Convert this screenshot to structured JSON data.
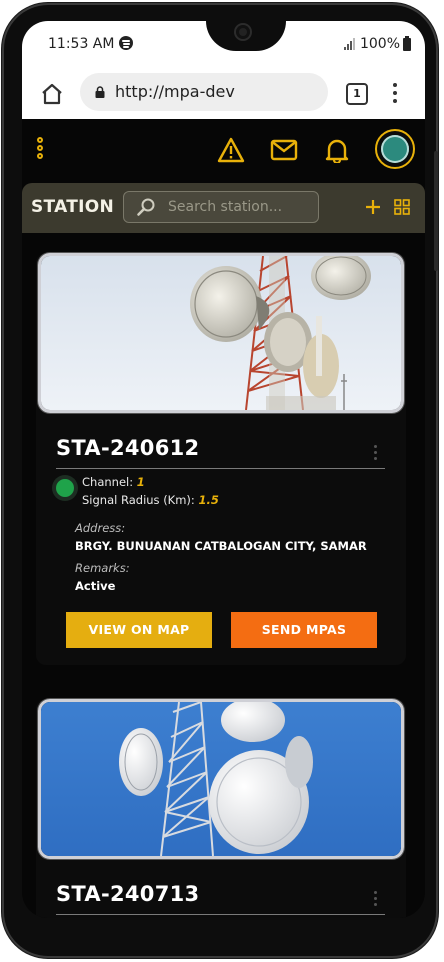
{
  "status_bar": {
    "time": "11:53 AM",
    "battery": "100%"
  },
  "browser": {
    "url": "http://mpa-dev",
    "tab_count": "1"
  },
  "station_bar": {
    "title": "STATION",
    "search_placeholder": "Search station..."
  },
  "stations": [
    {
      "code": "STA-240612",
      "channel_label": "Channel:",
      "channel": "1",
      "radius_label": "Signal Radius (Km):",
      "radius": "1.5",
      "address_label": "Address:",
      "address": "BRGY. BUNUANAN CATBALOGAN CITY, SAMAR",
      "remarks_label": "Remarks:",
      "remarks": "Active",
      "status_color": "#1fa34a",
      "view_label": "VIEW ON MAP",
      "send_label": "SEND MPAS"
    },
    {
      "code": "STA-240713"
    }
  ],
  "colors": {
    "accent": "#e8b10a",
    "map_button": "#e5ae10",
    "send_button": "#f46d12"
  }
}
